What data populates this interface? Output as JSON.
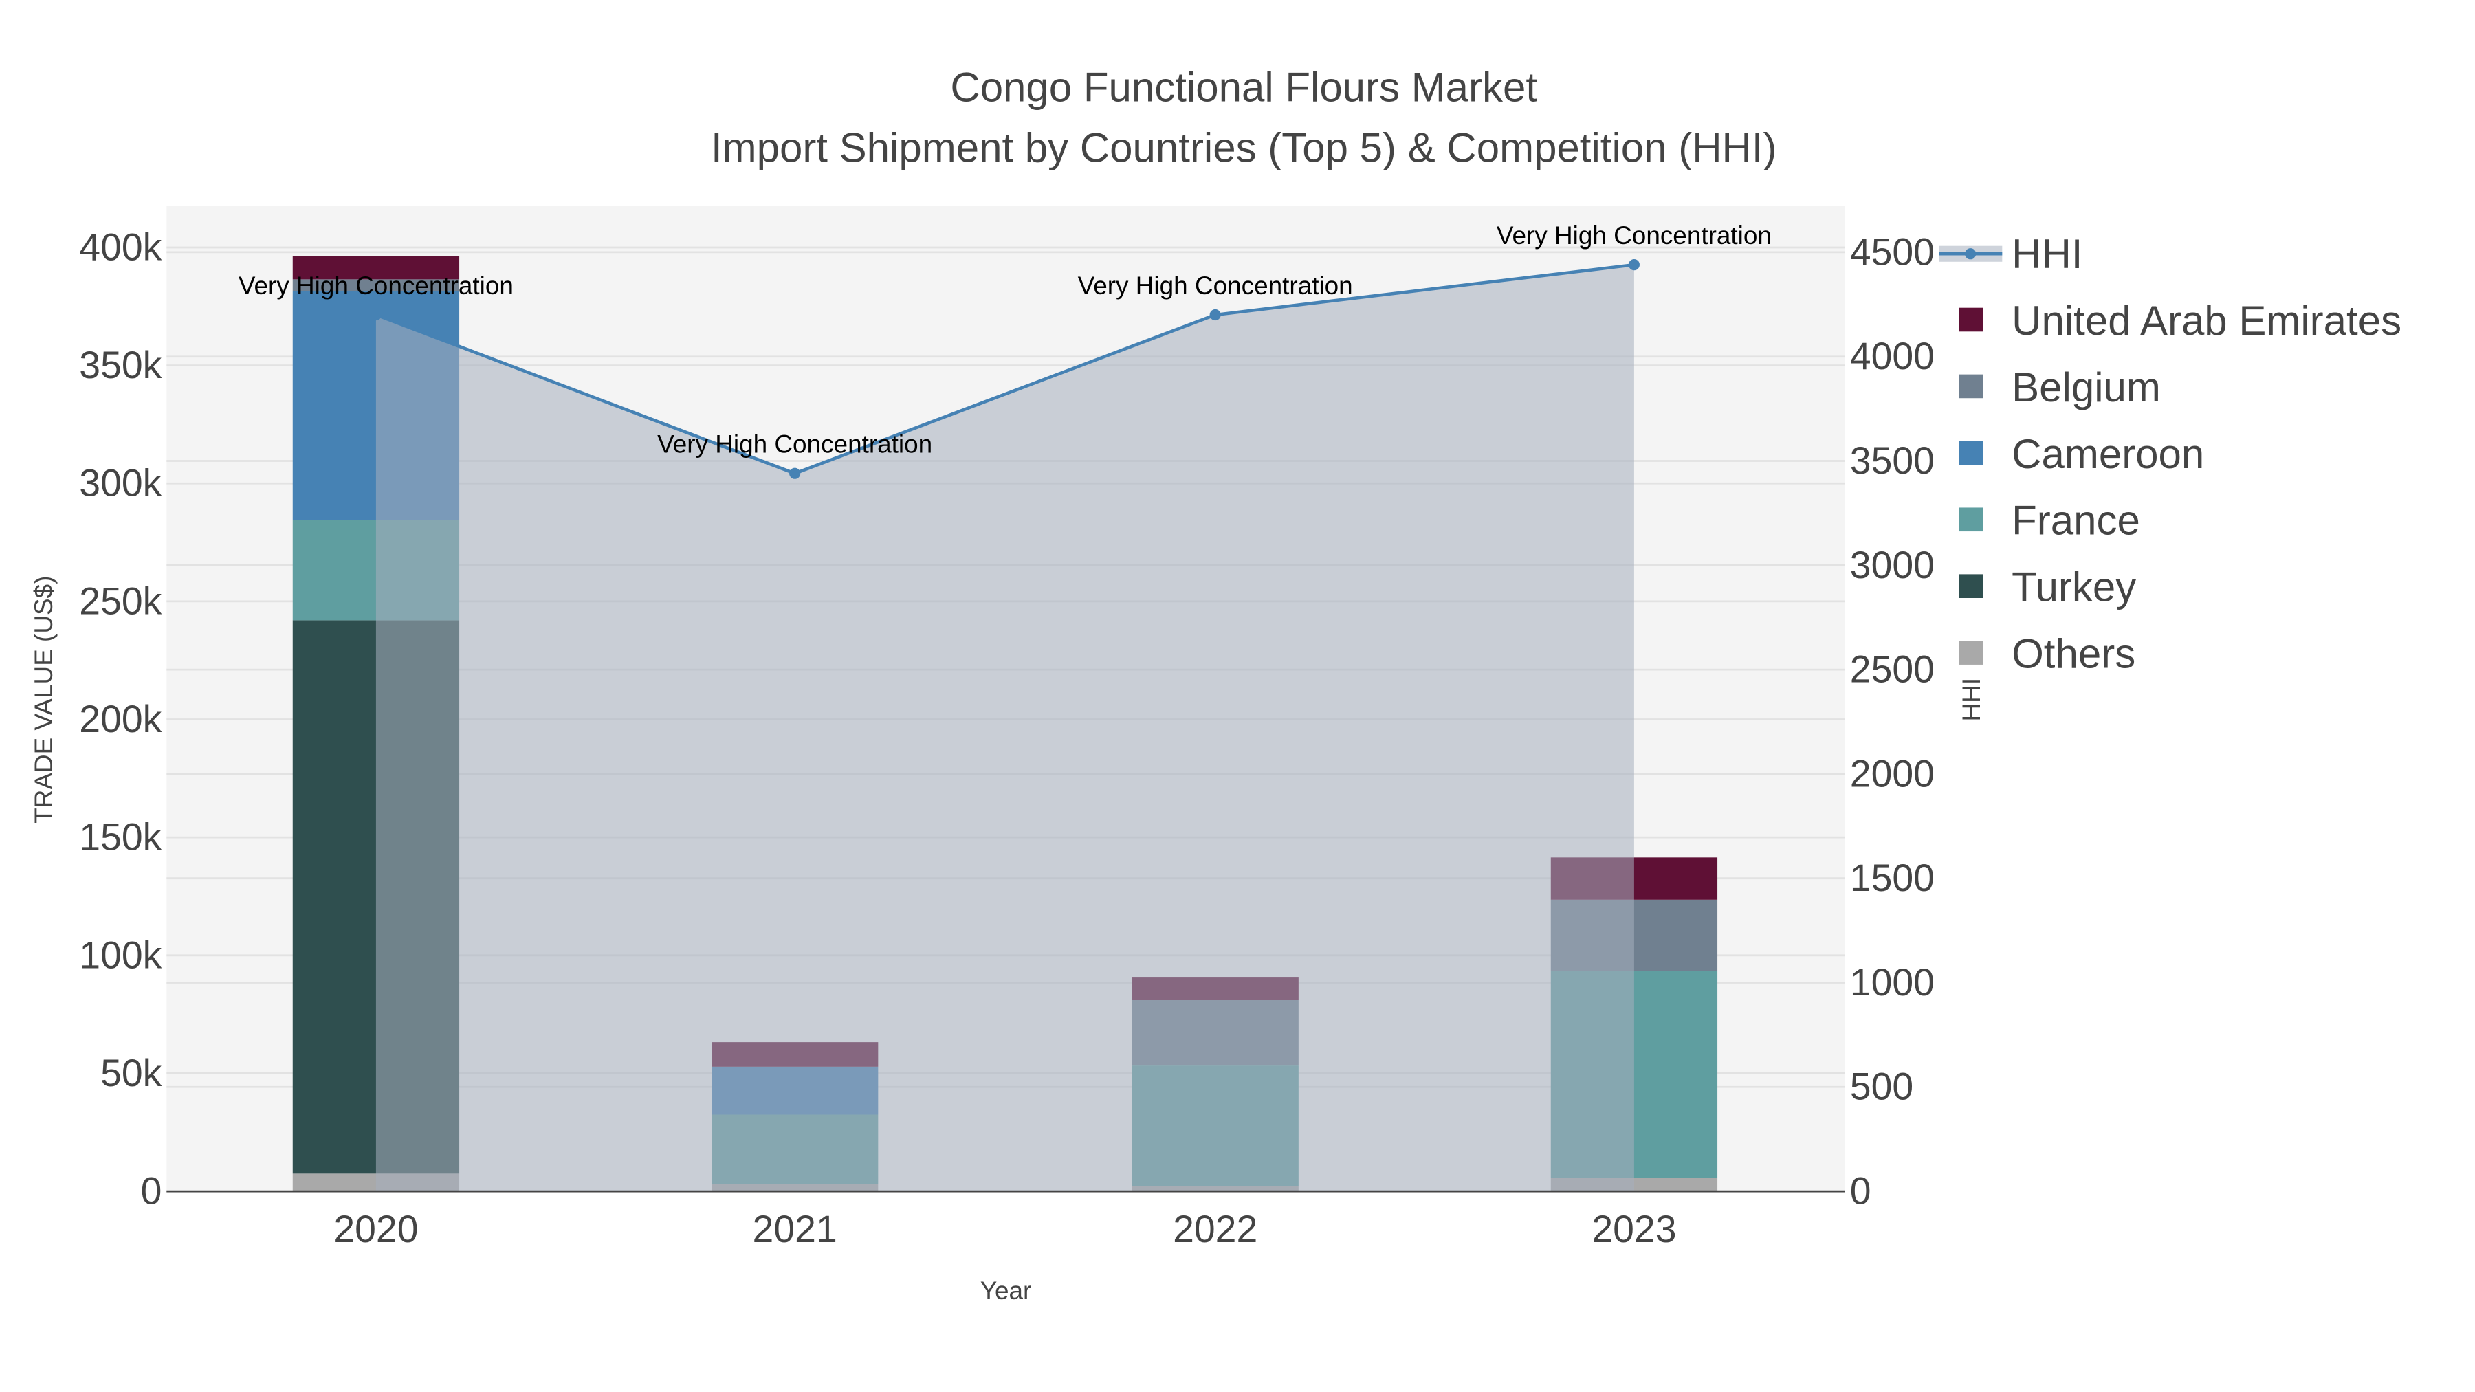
{
  "chart_data": {
    "type": "bar",
    "title": "Congo Functional Flours Market",
    "subtitle": "Import Shipment by Countries (Top 5) & Competition (HHI)",
    "xlabel": "Year",
    "ylabel": "TRADE VALUE (US$)",
    "y2label": "HHI",
    "categories": [
      "2020",
      "2021",
      "2022",
      "2023"
    ],
    "ylim": [
      0,
      415000
    ],
    "y2lim": [
      0,
      4700
    ],
    "yticks": [
      0,
      50000,
      100000,
      150000,
      200000,
      250000,
      300000,
      350000,
      400000
    ],
    "ytick_labels": [
      "0",
      "50k",
      "100k",
      "150k",
      "200k",
      "250k",
      "300k",
      "350k",
      "400k"
    ],
    "y2ticks": [
      0,
      500,
      1000,
      1500,
      2000,
      2500,
      3000,
      3500,
      4000,
      4500
    ],
    "y2tick_labels": [
      "0",
      "500",
      "1000",
      "1500",
      "2000",
      "2500",
      "3000",
      "3500",
      "4000",
      "4500"
    ],
    "stacked": true,
    "series": [
      {
        "name": "Others",
        "color": "#a9a9a9",
        "values": [
          7500,
          3000,
          2300,
          5800
        ]
      },
      {
        "name": "Turkey",
        "color": "#2f4f4f",
        "values": [
          234500,
          0,
          0,
          0
        ]
      },
      {
        "name": "France",
        "color": "#5f9ea0",
        "values": [
          42500,
          29500,
          51000,
          87700
        ]
      },
      {
        "name": "Cameroon",
        "color": "#4682b4",
        "values": [
          97000,
          20300,
          0,
          0
        ]
      },
      {
        "name": "Belgium",
        "color": "#708090",
        "values": [
          5000,
          0,
          27700,
          30100
        ]
      },
      {
        "name": "United Arab Emirates",
        "color": "#5f1035",
        "values": [
          10000,
          10400,
          9600,
          17900
        ]
      }
    ],
    "line": {
      "name": "HHI",
      "color": "#4682b4",
      "values": [
        4200,
        3440,
        4200,
        4440
      ],
      "axis": "right"
    },
    "annotations": [
      "Very High Concentration",
      "Very High Concentration",
      "Very High Concentration",
      "Very High Concentration"
    ],
    "legend_order": [
      "HHI",
      "United Arab Emirates",
      "Belgium",
      "Cameroon",
      "France",
      "Turkey",
      "Others"
    ],
    "legend_position": "right",
    "grid": true
  }
}
